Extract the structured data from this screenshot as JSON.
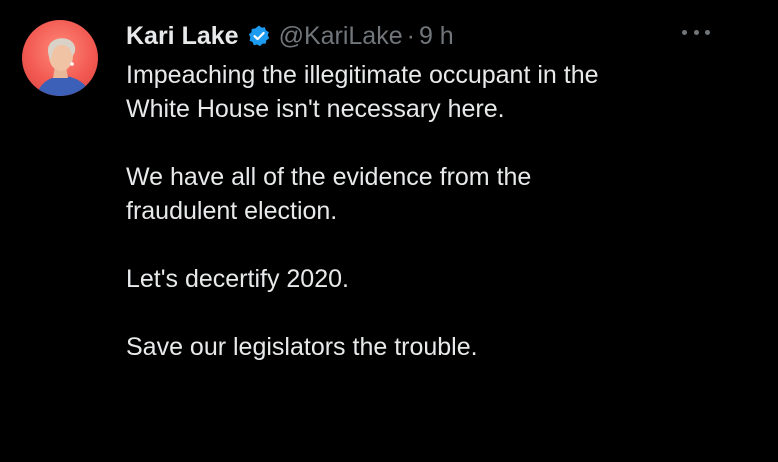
{
  "tweet": {
    "display_name": "Kari Lake",
    "handle": "@KariLake",
    "separator": "·",
    "time": "9 h",
    "verified_icon": "verified-badge-icon",
    "more_icon": "more-icon",
    "paragraphs": [
      "Impeaching the illegitimate occupant in the\nWhite House isn't necessary here.",
      "We have all of the evidence from the\nfraudulent election.",
      "Let's decertify 2020.",
      "Save our legislators the trouble."
    ]
  },
  "colors": {
    "background": "#000000",
    "text": "#e7e9ea",
    "secondary": "#71767b",
    "verified": "#1d9bf0"
  }
}
